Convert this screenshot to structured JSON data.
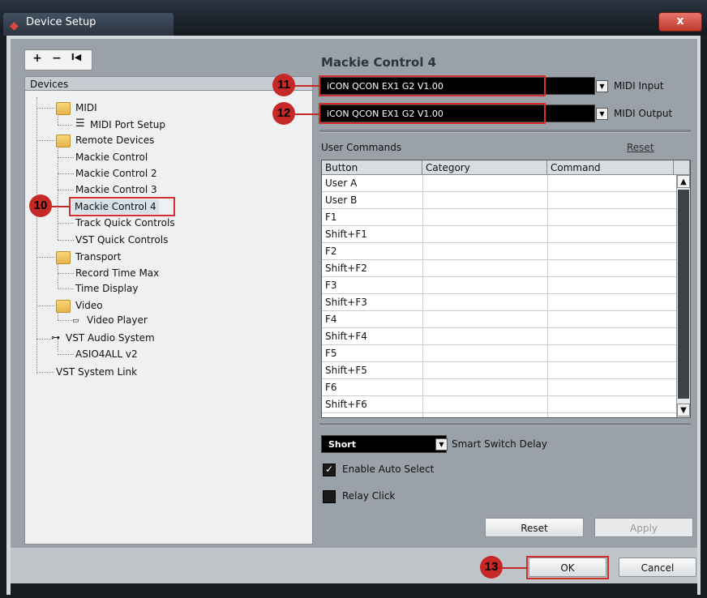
{
  "window": {
    "title": "Device Setup",
    "close_label": "x"
  },
  "toolbar": {
    "add": "+",
    "remove": "−",
    "reset": "I◀"
  },
  "devices_header": "Devices",
  "tree": {
    "midi": "MIDI",
    "midi_port_setup": "MIDI Port Setup",
    "remote_devices": "Remote Devices",
    "mackie_control": "Mackie Control",
    "mackie_control_2": "Mackie Control 2",
    "mackie_control_3": "Mackie Control 3",
    "mackie_control_4": "Mackie Control 4",
    "track_quick_controls": "Track Quick Controls",
    "vst_quick_controls": "VST Quick Controls",
    "transport": "Transport",
    "record_time_max": "Record Time Max",
    "time_display": "Time Display",
    "video": "Video",
    "video_player": "Video Player",
    "vst_audio_system": "VST Audio System",
    "asio4all": "ASIO4ALL v2",
    "vst_system_link": "VST System Link"
  },
  "device": {
    "title": "Mackie Control 4",
    "midi_input_value": "iCON QCON EX1 G2 V1.00",
    "midi_input_label": "MIDI Input",
    "midi_output_value": "iCON QCON EX1 G2 V1.00",
    "midi_output_label": "MIDI Output"
  },
  "user_commands": {
    "label": "User Commands",
    "reset_link": "Reset",
    "columns": [
      "Button",
      "Category",
      "Command"
    ],
    "rows": [
      "User A",
      "User B",
      "F1",
      "Shift+F1",
      "F2",
      "Shift+F2",
      "F3",
      "Shift+F3",
      "F4",
      "Shift+F4",
      "F5",
      "Shift+F5",
      "F6",
      "Shift+F6"
    ]
  },
  "smart_switch": {
    "value": "Short",
    "label": "Smart Switch Delay"
  },
  "enable_auto_select": {
    "label": "Enable Auto Select",
    "checked": true
  },
  "relay_click": {
    "label": "Relay Click",
    "checked": false
  },
  "buttons": {
    "reset": "Reset",
    "apply": "Apply",
    "ok": "OK",
    "cancel": "Cancel"
  },
  "callouts": {
    "c10": "10",
    "c11": "11",
    "c12": "12",
    "c13": "13"
  },
  "accent_color": "#c62828"
}
